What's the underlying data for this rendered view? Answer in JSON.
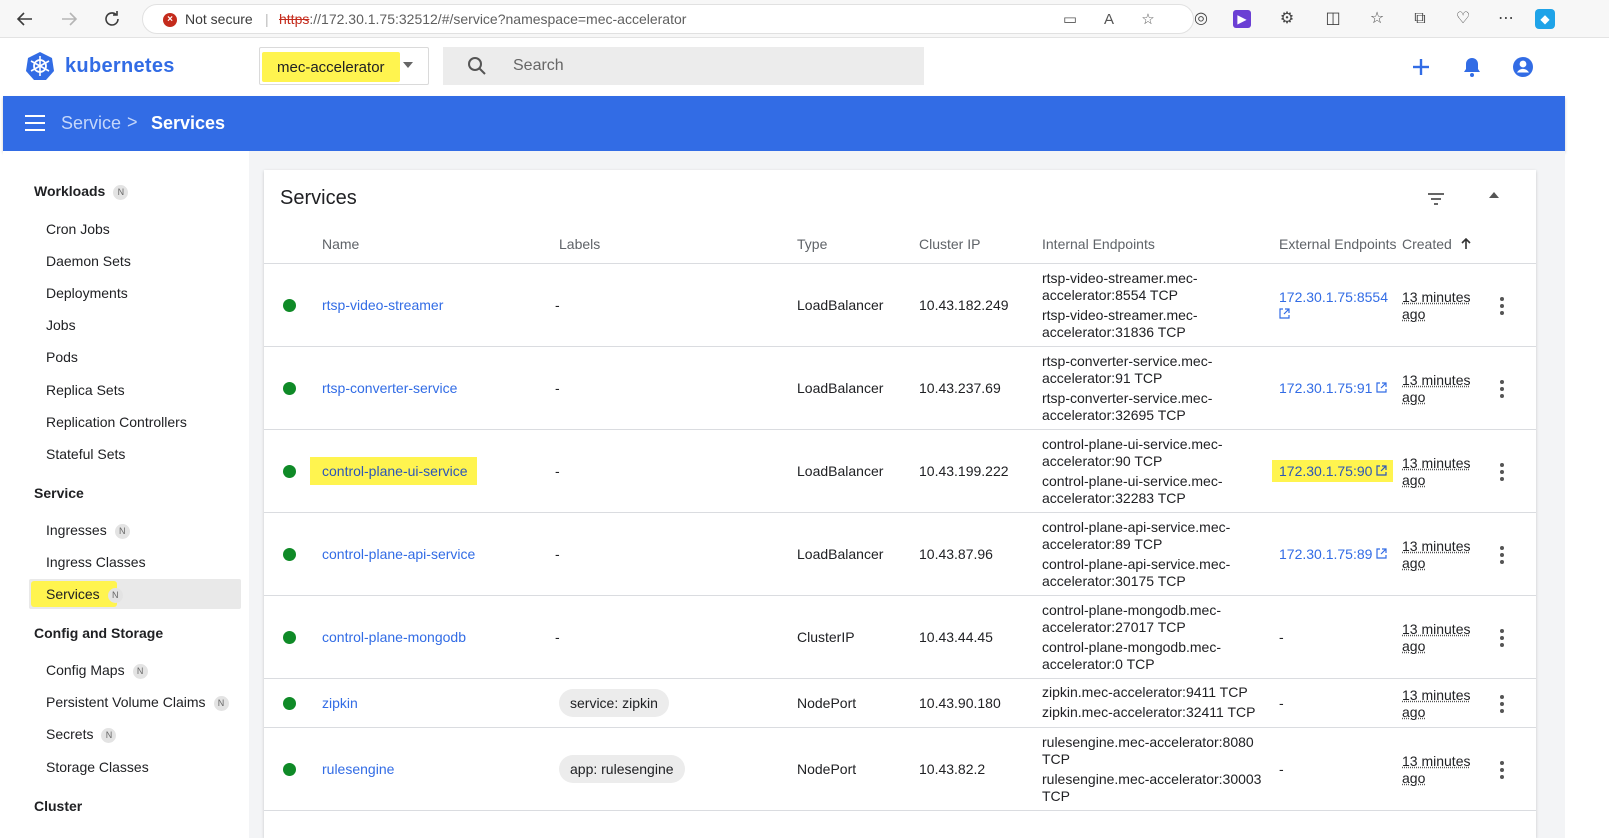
{
  "browser": {
    "security_label": "Not secure",
    "url_scheme": "https",
    "url_rest": "://172.30.1.75:32512/#/service?namespace=mec-accelerator"
  },
  "header": {
    "brand": "kubernetes",
    "namespace": "mec-accelerator",
    "search_placeholder": "Search"
  },
  "toolbar": {
    "breadcrumb_parent": "Service",
    "breadcrumb_sep": ">",
    "breadcrumb_current": "Services"
  },
  "sidebar": {
    "badge": "N",
    "sections": {
      "workloads": "Workloads",
      "service": "Service",
      "config": "Config and Storage",
      "cluster": "Cluster"
    },
    "items": [
      {
        "label": "Cron Jobs"
      },
      {
        "label": "Daemon Sets"
      },
      {
        "label": "Deployments"
      },
      {
        "label": "Jobs"
      },
      {
        "label": "Pods"
      },
      {
        "label": "Replica Sets"
      },
      {
        "label": "Replication Controllers"
      },
      {
        "label": "Stateful Sets"
      },
      {
        "label": "Ingresses"
      },
      {
        "label": "Ingress Classes"
      },
      {
        "label": "Services"
      },
      {
        "label": "Config Maps"
      },
      {
        "label": "Persistent Volume Claims"
      },
      {
        "label": "Secrets"
      },
      {
        "label": "Storage Classes"
      }
    ]
  },
  "services": {
    "title": "Services",
    "columns": {
      "name": "Name",
      "labels": "Labels",
      "type": "Type",
      "cluster_ip": "Cluster IP",
      "internal": "Internal Endpoints",
      "external": "External Endpoints",
      "created": "Created"
    },
    "rows": [
      {
        "name": "rtsp-video-streamer",
        "labels": "-",
        "type": "LoadBalancer",
        "cluster_ip": "10.43.182.249",
        "ep1a": "rtsp-video-streamer.mec-",
        "ep1b": "accelerator:8554 TCP",
        "ep2a": "rtsp-video-streamer.mec-",
        "ep2b": "accelerator:31836 TCP",
        "external": "172.30.1.75:8554",
        "created_a": "13 minutes",
        "created_b": "ago"
      },
      {
        "name": "rtsp-converter-service",
        "labels": "-",
        "type": "LoadBalancer",
        "cluster_ip": "10.43.237.69",
        "ep1a": "rtsp-converter-service.mec-",
        "ep1b": "accelerator:91 TCP",
        "ep2a": "rtsp-converter-service.mec-",
        "ep2b": "accelerator:32695 TCP",
        "external": "172.30.1.75:91",
        "created_a": "13 minutes",
        "created_b": "ago"
      },
      {
        "name": "control-plane-ui-service",
        "labels": "-",
        "type": "LoadBalancer",
        "cluster_ip": "10.43.199.222",
        "ep1a": "control-plane-ui-service.mec-",
        "ep1b": "accelerator:90 TCP",
        "ep2a": "control-plane-ui-service.mec-",
        "ep2b": "accelerator:32283 TCP",
        "external": "172.30.1.75:90",
        "created_a": "13 minutes",
        "created_b": "ago"
      },
      {
        "name": "control-plane-api-service",
        "labels": "-",
        "type": "LoadBalancer",
        "cluster_ip": "10.43.87.96",
        "ep1a": "control-plane-api-service.mec-",
        "ep1b": "accelerator:89 TCP",
        "ep2a": "control-plane-api-service.mec-",
        "ep2b": "accelerator:30175 TCP",
        "external": "172.30.1.75:89",
        "created_a": "13 minutes",
        "created_b": "ago"
      },
      {
        "name": "control-plane-mongodb",
        "labels": "-",
        "type": "ClusterIP",
        "cluster_ip": "10.43.44.45",
        "ep1a": "control-plane-mongodb.mec-",
        "ep1b": "accelerator:27017 TCP",
        "ep2a": "control-plane-mongodb.mec-",
        "ep2b": "accelerator:0 TCP",
        "external": "-",
        "created_a": "13 minutes",
        "created_b": "ago"
      },
      {
        "name": "zipkin",
        "labels": "service: zipkin",
        "type": "NodePort",
        "cluster_ip": "10.43.90.180",
        "ep1a": "zipkin.mec-accelerator:9411 TCP",
        "ep2a": "zipkin.mec-accelerator:32411 TCP",
        "external": "-",
        "created_a": "13 minutes",
        "created_b": "ago"
      },
      {
        "name": "rulesengine",
        "labels": "app: rulesengine",
        "type": "NodePort",
        "cluster_ip": "10.43.82.2",
        "ep1a": "rulesengine.mec-accelerator:8080",
        "ep1b": "TCP",
        "ep2a": "rulesengine.mec-accelerator:30003",
        "ep2b": "TCP",
        "external": "-",
        "created_a": "13 minutes",
        "created_b": "ago"
      }
    ]
  },
  "colors": {
    "brand_blue": "#326ce5",
    "status_green": "#0f8a27",
    "highlight_yellow": "#fff44f"
  }
}
